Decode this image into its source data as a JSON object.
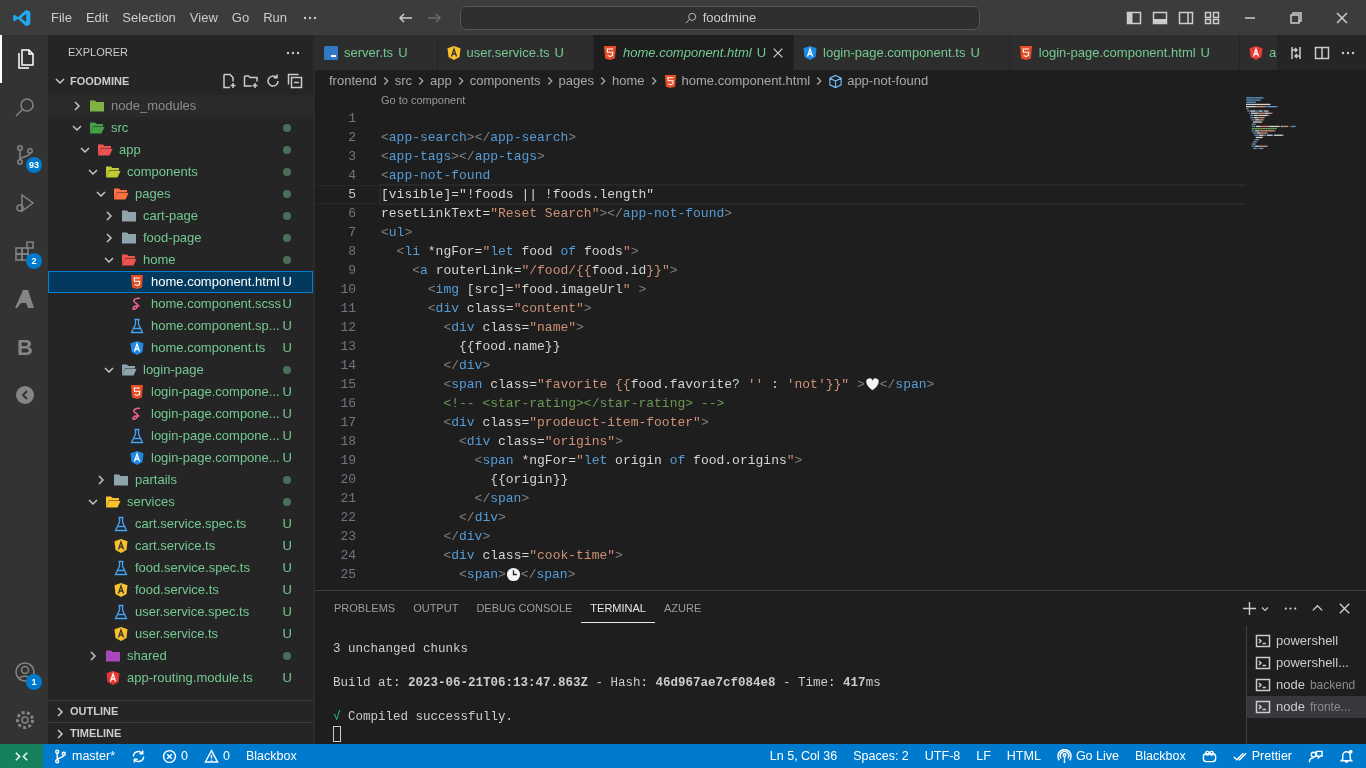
{
  "title_bar": {
    "menus": [
      "File",
      "Edit",
      "Selection",
      "View",
      "Go",
      "Run"
    ],
    "search": "foodmine"
  },
  "activity_bar": {
    "top": [
      {
        "kind": "explorer",
        "selected": true
      },
      {
        "kind": "search",
        "selected": false
      },
      {
        "kind": "source-control",
        "selected": false,
        "badge": "93"
      },
      {
        "kind": "run",
        "selected": false
      },
      {
        "kind": "extensions",
        "selected": false,
        "badge": "2"
      },
      {
        "kind": "azure",
        "selected": false
      },
      {
        "kind": "letter",
        "text": "B",
        "selected": false
      },
      {
        "kind": "gauge",
        "selected": false
      }
    ],
    "bottom": [
      {
        "kind": "account",
        "badge": "1"
      },
      {
        "kind": "settings"
      }
    ]
  },
  "explorer": {
    "title": "EXPLORER",
    "folder": "FOODMINE",
    "tree": [
      {
        "name": "node_modules",
        "kind": "folder",
        "color": "#7cb342",
        "expanded": false,
        "ignored": true,
        "changed": false,
        "selected": false
      },
      {
        "name": "src",
        "kind": "folder",
        "color": "#43a047",
        "expanded": true,
        "ignored": false,
        "changed": true,
        "selected": false,
        "children": [
          {
            "name": "app",
            "kind": "folder",
            "color": "#ef5350",
            "expanded": true,
            "changed": true,
            "selected": false,
            "children": [
              {
                "name": "components",
                "kind": "folder",
                "color": "#c0ca33",
                "expanded": true,
                "changed": true,
                "selected": false,
                "children": [
                  {
                    "name": "pages",
                    "kind": "folder",
                    "color": "#ff7043",
                    "expanded": true,
                    "changed": true,
                    "selected": false,
                    "children": [
                      {
                        "name": "cart-page",
                        "kind": "folder",
                        "color": "#90a4ae",
                        "expanded": false,
                        "changed": true,
                        "selected": false
                      },
                      {
                        "name": "food-page",
                        "kind": "folder",
                        "color": "#90a4ae",
                        "expanded": false,
                        "changed": true,
                        "selected": false
                      },
                      {
                        "name": "home",
                        "kind": "folder",
                        "color": "#ef5350",
                        "expanded": true,
                        "changed": true,
                        "selected": false,
                        "children": [
                          {
                            "name": "home.component.html",
                            "kind": "html",
                            "badge": "U",
                            "selected": true
                          },
                          {
                            "name": "home.component.scss",
                            "kind": "scss",
                            "badge": "U",
                            "selected": false
                          },
                          {
                            "name": "home.component.sp...",
                            "kind": "spec",
                            "badge": "U",
                            "selected": false
                          },
                          {
                            "name": "home.component.ts",
                            "kind": "component",
                            "badge": "U",
                            "selected": false
                          }
                        ]
                      },
                      {
                        "name": "login-page",
                        "kind": "folder",
                        "color": "#90a4ae",
                        "expanded": true,
                        "changed": true,
                        "selected": false,
                        "children": [
                          {
                            "name": "login-page.compone...",
                            "kind": "html",
                            "badge": "U",
                            "selected": false
                          },
                          {
                            "name": "login-page.compone...",
                            "kind": "scss",
                            "badge": "U",
                            "selected": false
                          },
                          {
                            "name": "login-page.compone...",
                            "kind": "spec",
                            "badge": "U",
                            "selected": false
                          },
                          {
                            "name": "login-page.compone...",
                            "kind": "component",
                            "badge": "U",
                            "selected": false
                          }
                        ]
                      }
                    ]
                  },
                  {
                    "name": "partails",
                    "kind": "folder",
                    "color": "#90a4ae",
                    "expanded": false,
                    "changed": true,
                    "selected": false
                  }
                ]
              },
              {
                "name": "services",
                "kind": "folder",
                "color": "#fbc02d",
                "expanded": true,
                "changed": true,
                "selected": false,
                "children": [
                  {
                    "name": "cart.service.spec.ts",
                    "kind": "spec",
                    "badge": "U",
                    "selected": false
                  },
                  {
                    "name": "cart.service.ts",
                    "kind": "service",
                    "badge": "U",
                    "selected": false
                  },
                  {
                    "name": "food.service.spec.ts",
                    "kind": "spec",
                    "badge": "U",
                    "selected": false
                  },
                  {
                    "name": "food.service.ts",
                    "kind": "service",
                    "badge": "U",
                    "selected": false
                  },
                  {
                    "name": "user.service.spec.ts",
                    "kind": "spec",
                    "badge": "U",
                    "selected": false
                  },
                  {
                    "name": "user.service.ts",
                    "kind": "service",
                    "badge": "U",
                    "selected": false
                  }
                ]
              },
              {
                "name": "shared",
                "kind": "folder",
                "color": "#ab47bc",
                "expanded": false,
                "changed": true,
                "selected": false
              },
              {
                "name": "app-routing.module.ts",
                "kind": "module",
                "badge": "U",
                "selected": false
              }
            ]
          }
        ]
      }
    ],
    "sections": [
      {
        "title": "OUTLINE",
        "expanded": false
      },
      {
        "title": "TIMELINE",
        "expanded": false
      }
    ]
  },
  "tabs": [
    {
      "label": "server.ts",
      "kind": "ts",
      "badge": "U",
      "selected": false,
      "preview": false
    },
    {
      "label": "user.service.ts",
      "kind": "service",
      "badge": "U",
      "selected": false,
      "preview": false
    },
    {
      "label": "home.component.html",
      "kind": "html",
      "badge": "U",
      "selected": true,
      "preview": true
    },
    {
      "label": "login-page.component.ts",
      "kind": "component",
      "badge": "U",
      "selected": false,
      "preview": false
    },
    {
      "label": "login-page.component.html",
      "kind": "html",
      "badge": "U",
      "selected": false,
      "preview": false
    },
    {
      "label": "a",
      "kind": "module",
      "selected": false,
      "preview": false
    }
  ],
  "breadcrumb": [
    {
      "text": "frontend"
    },
    {
      "text": "src"
    },
    {
      "text": "app"
    },
    {
      "text": "components"
    },
    {
      "text": "pages"
    },
    {
      "text": "home"
    },
    {
      "text": "home.component.html",
      "kind": "html"
    },
    {
      "text": "app-not-found",
      "kind": "element"
    }
  ],
  "editor": {
    "codelens": "Go to component",
    "lines": [
      {
        "number": "1",
        "current": false
      },
      {
        "number": "2",
        "current": false,
        "tokens": [
          {
            "kind": "p",
            "text": "<"
          },
          {
            "kind": "tag",
            "text": "app-search"
          },
          {
            "kind": "p",
            "text": "></"
          },
          {
            "kind": "tag",
            "text": "app-search"
          },
          {
            "kind": "p",
            "text": ">"
          }
        ]
      },
      {
        "number": "3",
        "current": false,
        "tokens": [
          {
            "kind": "p",
            "text": "<"
          },
          {
            "kind": "tag",
            "text": "app-tags"
          },
          {
            "kind": "p",
            "text": "></"
          },
          {
            "kind": "tag",
            "text": "app-tags"
          },
          {
            "kind": "p",
            "text": ">"
          }
        ]
      },
      {
        "number": "4",
        "current": false,
        "tokens": [
          {
            "kind": "p",
            "text": "<"
          },
          {
            "kind": "tag",
            "text": "app-not-found"
          }
        ]
      },
      {
        "number": "5",
        "current": true,
        "tokens": [
          {
            "kind": "txt",
            "text": "[visible]=\"!foods || !foods.length\""
          }
        ]
      },
      {
        "number": "6",
        "current": false,
        "tokens": [
          {
            "kind": "txt",
            "text": "resetLinkText="
          },
          {
            "kind": "str",
            "text": "\"Reset Search\""
          },
          {
            "kind": "p",
            "text": "></"
          },
          {
            "kind": "tag",
            "text": "app-not-found"
          },
          {
            "kind": "p",
            "text": ">"
          }
        ]
      },
      {
        "number": "7",
        "current": false,
        "tokens": [
          {
            "kind": "p",
            "text": "<"
          },
          {
            "kind": "tag",
            "text": "ul"
          },
          {
            "kind": "p",
            "text": ">"
          }
        ]
      },
      {
        "number": "8",
        "current": false,
        "tokens": [
          {
            "kind": "p",
            "text": "  <"
          },
          {
            "kind": "tag",
            "text": "li"
          },
          {
            "kind": "txt",
            "text": " *ngFor="
          },
          {
            "kind": "str",
            "text": "\""
          },
          {
            "kind": "kw",
            "text": "let"
          },
          {
            "kind": "txt",
            "text": " food "
          },
          {
            "kind": "kw",
            "text": "of"
          },
          {
            "kind": "txt",
            "text": " foods"
          },
          {
            "kind": "str",
            "text": "\""
          },
          {
            "kind": "p",
            "text": ">"
          }
        ]
      },
      {
        "number": "9",
        "current": false,
        "tokens": [
          {
            "kind": "p",
            "text": "    <"
          },
          {
            "kind": "tag",
            "text": "a"
          },
          {
            "kind": "txt",
            "text": " routerLink="
          },
          {
            "kind": "str",
            "text": "\"/food/{{"
          },
          {
            "kind": "txt",
            "text": "food.id"
          },
          {
            "kind": "str",
            "text": "}}\""
          },
          {
            "kind": "p",
            "text": ">"
          }
        ]
      },
      {
        "number": "10",
        "current": false,
        "tokens": [
          {
            "kind": "p",
            "text": "      <"
          },
          {
            "kind": "tag",
            "text": "img"
          },
          {
            "kind": "txt",
            "text": " [src]="
          },
          {
            "kind": "str",
            "text": "\""
          },
          {
            "kind": "txt",
            "text": "food.imageUrl"
          },
          {
            "kind": "str",
            "text": "\""
          },
          {
            "kind": "p",
            "text": " >"
          }
        ]
      },
      {
        "number": "11",
        "current": false,
        "tokens": [
          {
            "kind": "p",
            "text": "      <"
          },
          {
            "kind": "tag",
            "text": "div"
          },
          {
            "kind": "txt",
            "text": " class="
          },
          {
            "kind": "str",
            "text": "\"content\""
          },
          {
            "kind": "p",
            "text": ">"
          }
        ]
      },
      {
        "number": "12",
        "current": false,
        "tokens": [
          {
            "kind": "p",
            "text": "        <"
          },
          {
            "kind": "tag",
            "text": "div"
          },
          {
            "kind": "txt",
            "text": " class="
          },
          {
            "kind": "str",
            "text": "\"name\""
          },
          {
            "kind": "p",
            "text": ">"
          }
        ]
      },
      {
        "number": "13",
        "current": false,
        "tokens": [
          {
            "kind": "txt",
            "text": "          {{food.name}}"
          }
        ]
      },
      {
        "number": "14",
        "current": false,
        "tokens": [
          {
            "kind": "p",
            "text": "        </"
          },
          {
            "kind": "tag",
            "text": "div"
          },
          {
            "kind": "p",
            "text": ">"
          }
        ]
      },
      {
        "number": "15",
        "current": false,
        "tokens": [
          {
            "kind": "p",
            "text": "        <"
          },
          {
            "kind": "tag",
            "text": "span"
          },
          {
            "kind": "txt",
            "text": " class="
          },
          {
            "kind": "str",
            "text": "\"favorite {{"
          },
          {
            "kind": "txt",
            "text": "food.favorite? "
          },
          {
            "kind": "str",
            "text": "''"
          },
          {
            "kind": "txt",
            "text": " : "
          },
          {
            "kind": "str",
            "text": "'not'}}\""
          },
          {
            "kind": "p",
            "text": " >"
          },
          {
            "kind": "heart"
          },
          {
            "kind": "p",
            "text": "</"
          },
          {
            "kind": "tag",
            "text": "span"
          },
          {
            "kind": "p",
            "text": ">"
          }
        ]
      },
      {
        "number": "16",
        "current": false,
        "tokens": [
          {
            "kind": "com",
            "text": "        <!-- <star-rating></star-rating> -->"
          }
        ]
      },
      {
        "number": "17",
        "current": false,
        "tokens": [
          {
            "kind": "p",
            "text": "        <"
          },
          {
            "kind": "tag",
            "text": "div"
          },
          {
            "kind": "txt",
            "text": " class="
          },
          {
            "kind": "str",
            "text": "\"prodeuct-item-footer\""
          },
          {
            "kind": "p",
            "text": ">"
          }
        ]
      },
      {
        "number": "18",
        "current": false,
        "tokens": [
          {
            "kind": "p",
            "text": "          <"
          },
          {
            "kind": "tag",
            "text": "div"
          },
          {
            "kind": "txt",
            "text": " class="
          },
          {
            "kind": "str",
            "text": "\"origins\""
          },
          {
            "kind": "p",
            "text": ">"
          }
        ]
      },
      {
        "number": "19",
        "current": false,
        "tokens": [
          {
            "kind": "p",
            "text": "            <"
          },
          {
            "kind": "tag",
            "text": "span"
          },
          {
            "kind": "txt",
            "text": " *ngFor="
          },
          {
            "kind": "str",
            "text": "\""
          },
          {
            "kind": "kw",
            "text": "let"
          },
          {
            "kind": "txt",
            "text": " origin "
          },
          {
            "kind": "kw",
            "text": "of"
          },
          {
            "kind": "txt",
            "text": " food.origins"
          },
          {
            "kind": "str",
            "text": "\""
          },
          {
            "kind": "p",
            "text": ">"
          }
        ]
      },
      {
        "number": "20",
        "current": false,
        "tokens": [
          {
            "kind": "txt",
            "text": "              {{origin}}"
          }
        ]
      },
      {
        "number": "21",
        "current": false,
        "tokens": [
          {
            "kind": "p",
            "text": "            </"
          },
          {
            "kind": "tag",
            "text": "span"
          },
          {
            "kind": "p",
            "text": ">"
          }
        ]
      },
      {
        "number": "22",
        "current": false,
        "tokens": [
          {
            "kind": "p",
            "text": "          </"
          },
          {
            "kind": "tag",
            "text": "div"
          },
          {
            "kind": "p",
            "text": ">"
          }
        ]
      },
      {
        "number": "23",
        "current": false,
        "tokens": [
          {
            "kind": "p",
            "text": "        </"
          },
          {
            "kind": "tag",
            "text": "div"
          },
          {
            "kind": "p",
            "text": ">"
          }
        ]
      },
      {
        "number": "24",
        "current": false,
        "tokens": [
          {
            "kind": "p",
            "text": "        <"
          },
          {
            "kind": "tag",
            "text": "div"
          },
          {
            "kind": "txt",
            "text": " class="
          },
          {
            "kind": "str",
            "text": "\"cook-time\""
          },
          {
            "kind": "p",
            "text": ">"
          }
        ]
      },
      {
        "number": "25",
        "current": false,
        "tokens": [
          {
            "kind": "p",
            "text": "          <"
          },
          {
            "kind": "tag",
            "text": "span"
          },
          {
            "kind": "p",
            "text": ">"
          },
          {
            "kind": "clock"
          },
          {
            "kind": "p",
            "text": "</"
          },
          {
            "kind": "tag",
            "text": "span"
          },
          {
            "kind": "p",
            "text": ">"
          }
        ]
      }
    ]
  },
  "panel": {
    "tabs": [
      {
        "label": "PROBLEMS",
        "selected": false
      },
      {
        "label": "OUTPUT",
        "selected": false
      },
      {
        "label": "DEBUG CONSOLE",
        "selected": false
      },
      {
        "label": "TERMINAL",
        "selected": true
      },
      {
        "label": "AZURE",
        "selected": false
      }
    ],
    "terminal": {
      "cursor": true,
      "lines": [
        {
          "kind": "plain",
          "text": "3 unchanged chunks"
        },
        {
          "kind": "plain",
          "text": "Build at: **2023-06-21T06:13:47.863Z** - Hash: **46d967ae7cf084e8** - Time: **417**ms"
        },
        {
          "kind": "success",
          "mark": "√",
          "text": "Compiled successfully."
        }
      ]
    },
    "terminals": [
      {
        "name": "powershell",
        "selected": false
      },
      {
        "name": "powershell...",
        "selected": false
      },
      {
        "name": "node",
        "detail": "backend",
        "selected": false
      },
      {
        "name": "node",
        "detail": "fronte...",
        "selected": true
      }
    ]
  },
  "status_bar": {
    "left": [
      {
        "kind": "remote"
      },
      {
        "kind": "branch",
        "text": "master*"
      },
      {
        "kind": "sync"
      },
      {
        "kind": "errors",
        "text": "0"
      },
      {
        "kind": "warnings",
        "text": "0"
      },
      {
        "kind": "plain",
        "text": "Blackbox"
      }
    ],
    "right": [
      {
        "kind": "plain",
        "text": "Ln 5, Col 36"
      },
      {
        "kind": "plain",
        "text": "Spaces: 2"
      },
      {
        "kind": "plain",
        "text": "UTF-8"
      },
      {
        "kind": "plain",
        "text": "LF"
      },
      {
        "kind": "plain",
        "text": "HTML"
      },
      {
        "kind": "golive",
        "text": "Go Live"
      },
      {
        "kind": "plain",
        "text": "Blackbox"
      },
      {
        "kind": "copilot"
      },
      {
        "kind": "prettier",
        "text": "Prettier"
      },
      {
        "kind": "feedback"
      },
      {
        "kind": "bell"
      }
    ]
  }
}
